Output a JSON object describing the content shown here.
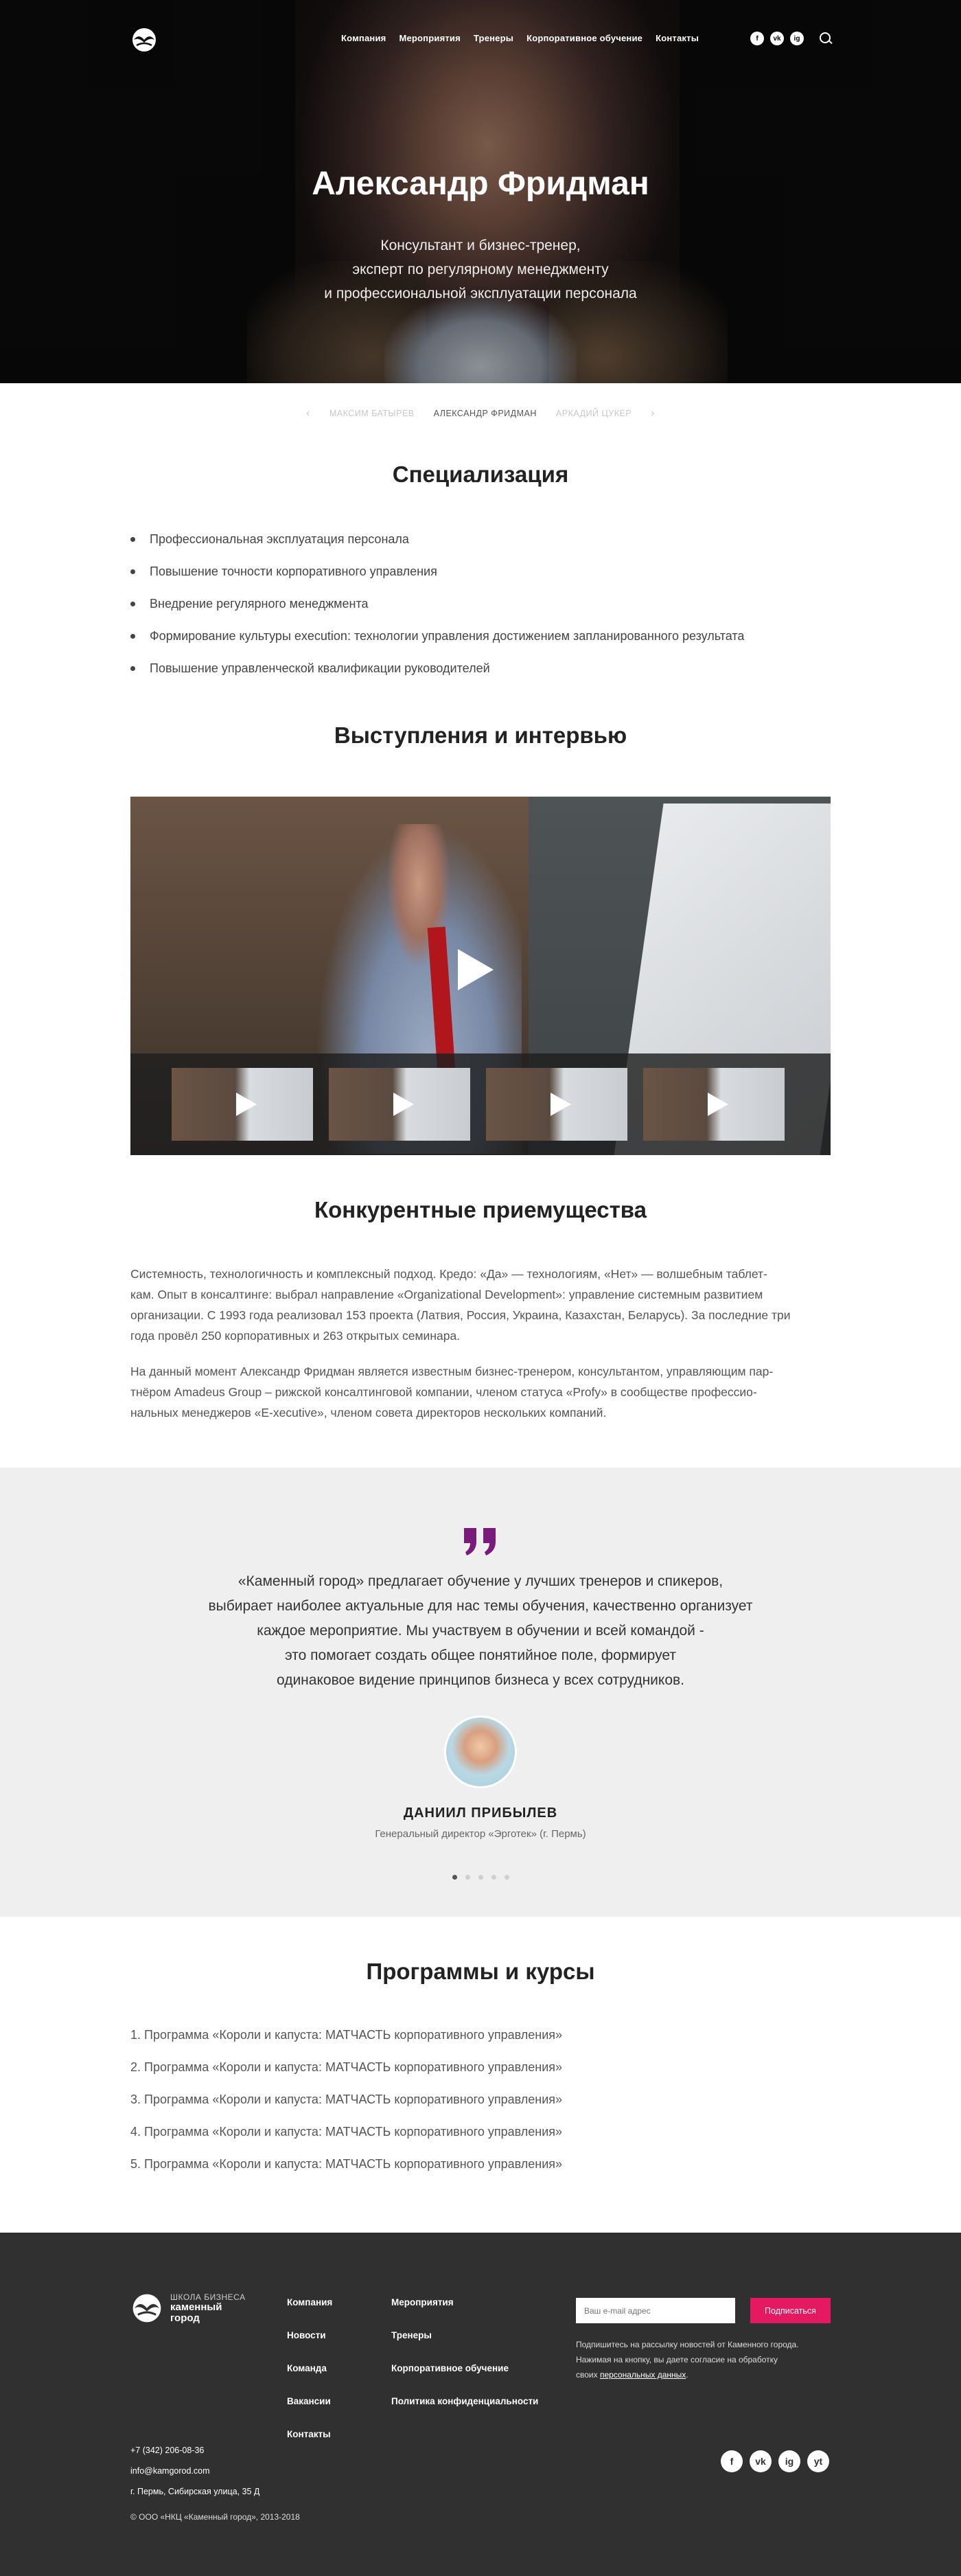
{
  "header": {
    "menu": [
      "Компания",
      "Мероприятия",
      "Тренеры",
      "Корпоративное обучение",
      "Контакты"
    ],
    "social": [
      "f",
      "vk",
      "ig"
    ]
  },
  "hero": {
    "name": "Александр Фридман",
    "subtitle": [
      "Консультант и бизнес-тренер,",
      "эксперт по регулярному менеджменту",
      "и профессиональной эксплуатации персонала"
    ]
  },
  "trainer_nav": {
    "prev": "МАКСИМ БАТЫРЕВ",
    "current": "АЛЕКСАНДР ФРИДМАН",
    "next": "АРКАДИЙ ЦУКЕР"
  },
  "specialization": {
    "title": "Специализация",
    "items": [
      "Профессиональная эксплуатация персонала",
      "Повышение точности корпоративного управления",
      "Внедрение регулярного менеджмента",
      "Формирование культуры execution: технологии управления достижением запланированного результата",
      "Повышение управленческой квалификации руководителей"
    ]
  },
  "talks": {
    "title": "Выступления и интервью"
  },
  "advantages": {
    "title": "Конкурентные приемущества",
    "p1": [
      "Системность, технологичность и комплексный подход. Кредо: «Да» — технологиям, «Нет» — волшебным таблет-",
      "кам. Опыт в консалтинге: выбрал направление «Organizational Development»: управление системным развитием",
      "организации. С 1993 года реализовал 153 проекта (Латвия, Россия, Украина, Казахстан, Беларусь). За последние три",
      "года провёл 250 корпоративных и 263 открытых семинара."
    ],
    "p2": [
      "На данный момент Александр Фридман является известным бизнес-тренером, консультантом, управляющим пар-",
      "тнёром Amadeus Group – рижской консалтинговой компании, членом статуса «Profy» в сообществе профессио-",
      "нальных менеджеров «E-xecutive», членом совета директоров нескольких компаний."
    ]
  },
  "testimonial": {
    "text": [
      "«Каменный город» предлагает обучение у лучших тренеров и спикеров,",
      "выбирает наиболее актуальные для нас темы обучения, качественно организует",
      "каждое мероприятие. Мы участвуем в обучении и всей командой -",
      "это помогает создать общее понятийное поле, формирует",
      "одинаковое видение принципов бизнеса у всех сотрудников."
    ],
    "name": "ДАНИИЛ ПРИБЫЛЕВ",
    "role": "Генеральный директор «Эрготек» (г. Пермь)"
  },
  "programs": {
    "title": "Программы и курсы",
    "items": [
      "1. Программа «Короли и капуста: МАТЧАСТЬ корпоративного управления»",
      "2. Программа «Короли и капуста: МАТЧАСТЬ корпоративного управления»",
      "3. Программа «Короли и капуста: МАТЧАСТЬ корпоративного управления»",
      "4. Программа «Короли и капуста: МАТЧАСТЬ корпоративного управления»",
      "5. Программа «Короли и капуста: МАТЧАСТЬ корпоративного управления»"
    ]
  },
  "footer": {
    "logo_school": "ШКОЛА БИЗНЕСА",
    "logo_brand_1": "каменный",
    "logo_brand_2": "город",
    "col1": [
      "Компания",
      "Новости",
      "Команда",
      "Вакансии",
      "Контакты"
    ],
    "col2": [
      "Мероприятия",
      "Тренеры",
      "Корпоративное обучение",
      "Политика конфиденциальности"
    ],
    "email_placeholder": "Ваш e-mail адрес",
    "subscribe": "Подписаться",
    "note_1": "Подпишитесь на рассылку новостей от Каменного города.",
    "note_2": "Нажимая на кнопку, вы даете согласие на обработку",
    "note_3": "своих ",
    "note_link": "персональных данных",
    "note_end": ".",
    "phone": "+7 (342) 206-08-36",
    "email": "info@kamgorod.com",
    "address": "г. Пермь, Сибирская улица, 35 Д",
    "copyright": "© ООО «НКЦ «Каменный город», 2013-2018",
    "social": [
      "f",
      "vk",
      "ig",
      "yt"
    ]
  },
  "colors": {
    "accent": "#e5195f",
    "quote": "#7a1a7a",
    "footer_bg": "#303030",
    "testimonial_bg": "#efeff0"
  }
}
